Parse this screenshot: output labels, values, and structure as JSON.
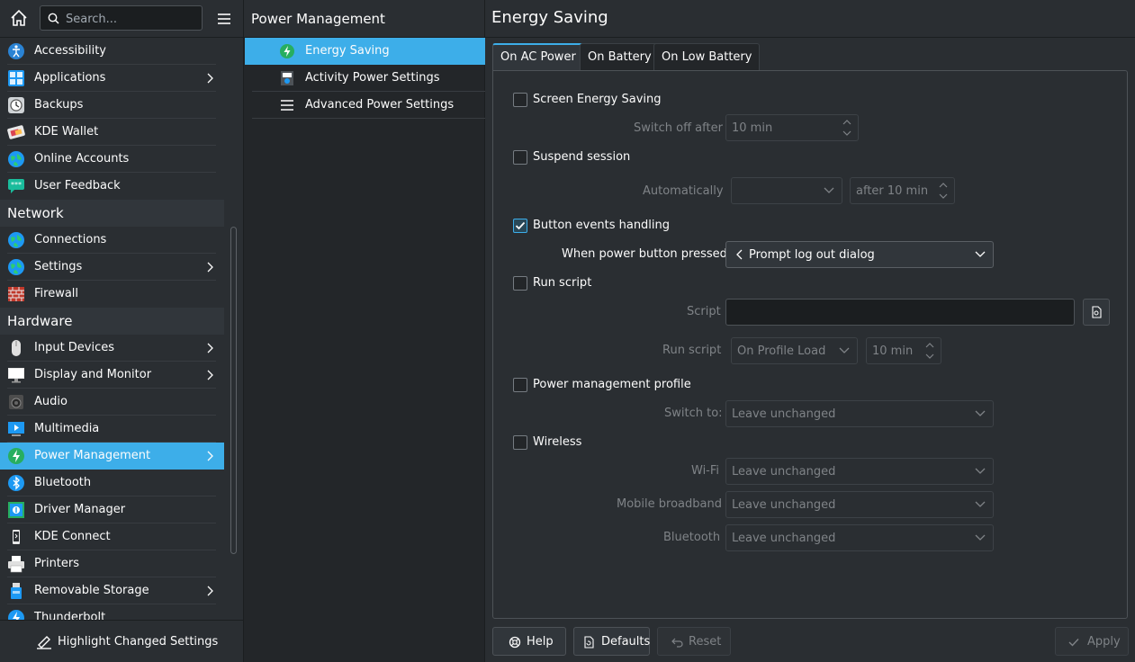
{
  "sidebar": {
    "search_placeholder": "Search...",
    "items": [
      {
        "label": "Accessibility",
        "icon": "accessibility-icon",
        "chevron": false
      },
      {
        "label": "Applications",
        "icon": "applications-icon",
        "chevron": true
      },
      {
        "label": "Backups",
        "icon": "backups-icon",
        "chevron": false
      },
      {
        "label": "KDE Wallet",
        "icon": "wallet-icon",
        "chevron": false
      },
      {
        "label": "Online Accounts",
        "icon": "online-accounts-icon",
        "chevron": false
      },
      {
        "label": "User Feedback",
        "icon": "user-feedback-icon",
        "chevron": false
      }
    ],
    "network_header": "Network",
    "network_items": [
      {
        "label": "Connections",
        "icon": "globe-icon",
        "chevron": false
      },
      {
        "label": "Settings",
        "icon": "globe-icon",
        "chevron": true
      },
      {
        "label": "Firewall",
        "icon": "firewall-icon",
        "chevron": false
      }
    ],
    "hardware_header": "Hardware",
    "hardware_items": [
      {
        "label": "Input Devices",
        "icon": "mouse-icon",
        "chevron": true
      },
      {
        "label": "Display and Monitor",
        "icon": "monitor-icon",
        "chevron": true
      },
      {
        "label": "Audio",
        "icon": "speaker-icon",
        "chevron": false
      },
      {
        "label": "Multimedia",
        "icon": "multimedia-icon",
        "chevron": false
      },
      {
        "label": "Power Management",
        "icon": "power-icon",
        "chevron": true,
        "selected": true
      },
      {
        "label": "Bluetooth",
        "icon": "bluetooth-icon",
        "chevron": false
      },
      {
        "label": "Driver Manager",
        "icon": "driver-icon",
        "chevron": false
      },
      {
        "label": "KDE Connect",
        "icon": "kde-connect-icon",
        "chevron": false
      },
      {
        "label": "Printers",
        "icon": "printer-icon",
        "chevron": false
      },
      {
        "label": "Removable Storage",
        "icon": "usb-icon",
        "chevron": true
      },
      {
        "label": "Thunderbolt",
        "icon": "thunderbolt-icon",
        "chevron": false
      }
    ],
    "highlight_button": "Highlight Changed Settings"
  },
  "middle": {
    "title": "Power Management",
    "items": [
      {
        "label": "Energy Saving",
        "icon": "energy-saving-icon",
        "selected": true
      },
      {
        "label": "Activity Power Settings",
        "icon": "activity-icon",
        "selected": false
      },
      {
        "label": "Advanced Power Settings",
        "icon": "hamburger-icon",
        "selected": false
      }
    ]
  },
  "page": {
    "title": "Energy Saving",
    "tabs": [
      "On AC Power",
      "On Battery",
      "On Low Battery"
    ],
    "screen_energy_saving": {
      "label": "Screen Energy Saving",
      "checked": false,
      "switch_off_label": "Switch off after",
      "switch_off_value": "10 min"
    },
    "suspend_session": {
      "label": "Suspend session",
      "checked": false,
      "auto_label": "Automatically",
      "auto_value": "",
      "after_value": "after 10 min"
    },
    "button_events": {
      "label": "Button events handling",
      "checked": true,
      "power_button_label": "When power button pressed",
      "power_button_value": "Prompt log out dialog"
    },
    "run_script": {
      "label": "Run script",
      "checked": false,
      "script_label": "Script",
      "script_value": "",
      "run_label": "Run script",
      "run_value": "On Profile Load",
      "run_time": "10 min"
    },
    "power_profile": {
      "label": "Power management profile",
      "checked": false,
      "switch_label": "Switch to:",
      "switch_value": "Leave unchanged"
    },
    "wireless": {
      "label": "Wireless",
      "checked": false,
      "wifi_label": "Wi-Fi",
      "wifi_value": "Leave unchanged",
      "mobile_label": "Mobile broadband",
      "mobile_value": "Leave unchanged",
      "bt_label": "Bluetooth",
      "bt_value": "Leave unchanged"
    }
  },
  "footer": {
    "help": "Help",
    "defaults": "Defaults",
    "reset": "Reset",
    "apply": "Apply"
  },
  "colors": {
    "accent": "#3daee9",
    "background": "#2a2e32",
    "text": "#fcfcfc",
    "disabled_text": "#7f8387"
  }
}
